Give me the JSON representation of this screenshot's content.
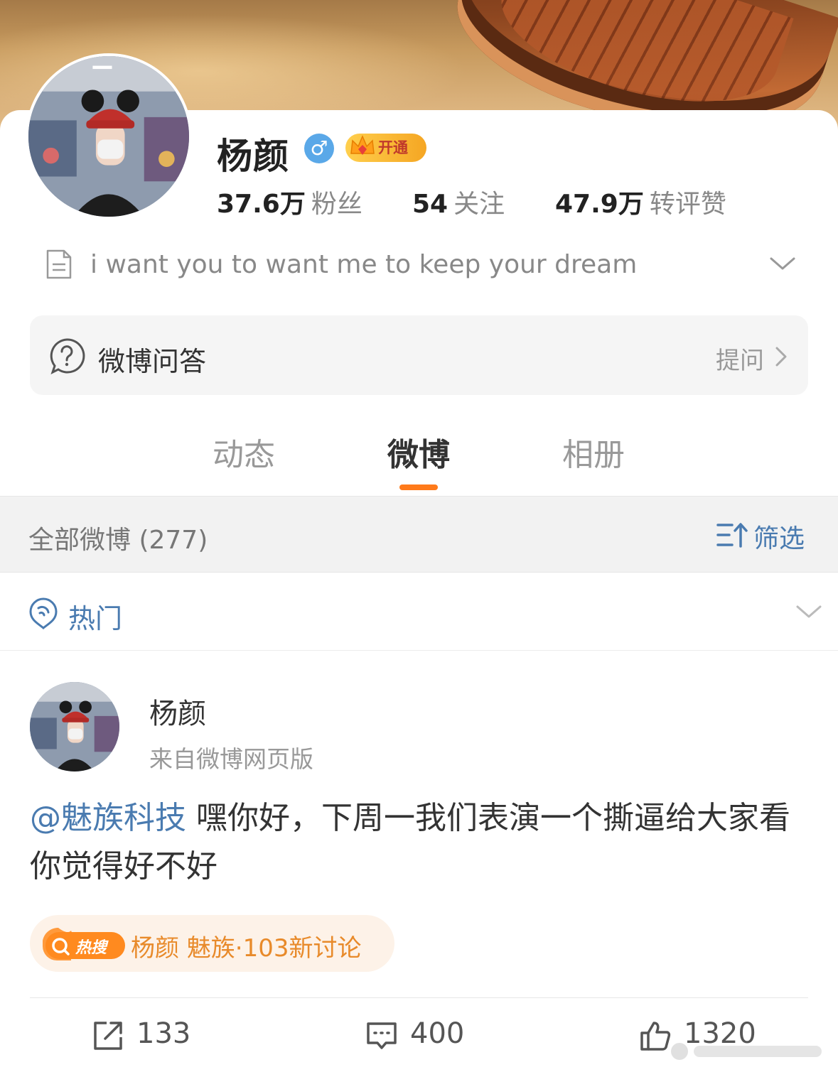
{
  "profile": {
    "name": "杨颜",
    "gender_symbol": "♂",
    "vip_label": "开通",
    "stats": [
      {
        "num": "37.6万",
        "label": "粉丝"
      },
      {
        "num": "54",
        "label": "关注"
      },
      {
        "num": "47.9万",
        "label": "转评赞"
      }
    ],
    "bio": "i want you to want me to keep your dream"
  },
  "qa": {
    "title": "微博问答",
    "action": "提问"
  },
  "tabs": [
    {
      "label": "动态",
      "active": false
    },
    {
      "label": "微博",
      "active": true
    },
    {
      "label": "相册",
      "active": false
    }
  ],
  "filter": {
    "all_label": "全部微博 (277)",
    "filter_label": "筛选"
  },
  "hot": {
    "label": "热门"
  },
  "post": {
    "author": "杨颜",
    "source": "来自微博网页版",
    "mention": "@魅族科技",
    "text": " 嘿你好，下周一我们表演一个撕逼给大家看你觉得好不好",
    "hot_badge": "热搜",
    "hot_topic": "杨颜 魅族·103新讨论",
    "actions": {
      "repost": "133",
      "comment": "400",
      "like": "1320"
    }
  },
  "colors": {
    "accent_orange": "#ff7a1a",
    "link_blue": "#4a7bb0",
    "hot_orange": "#e88a2a"
  }
}
